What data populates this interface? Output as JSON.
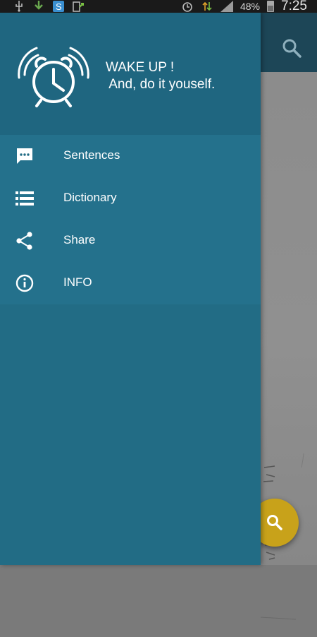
{
  "status_bar": {
    "battery_percent": "48%",
    "time": "7:25"
  },
  "drawer": {
    "header": {
      "logo_icon": "alarm-clock-ringing-icon",
      "title": "WAKE UP !",
      "subtitle": " And, do it youself."
    },
    "items": [
      {
        "label": "Sentences",
        "icon": "chat-dots-icon"
      },
      {
        "label": "Dictionary",
        "icon": "list-icon"
      },
      {
        "label": "Share",
        "icon": "share-icon"
      },
      {
        "label": "INFO",
        "icon": "info-icon"
      }
    ]
  },
  "app": {
    "toolbar_action_icon": "search-icon",
    "fab_icon": "search-icon"
  },
  "colors": {
    "drawer_bg": "#226c85",
    "drawer_header_bg": "#1f6680",
    "toolbar_bg": "#1d4657",
    "fab": "#c8a21a"
  }
}
